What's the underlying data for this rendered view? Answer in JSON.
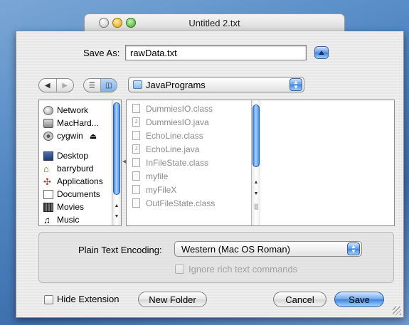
{
  "window": {
    "title": "Untitled 2.txt"
  },
  "save_as": {
    "label": "Save As:",
    "value": "rawData.txt"
  },
  "location": {
    "folder": "JavaPrograms"
  },
  "sidebar": {
    "devices": [
      {
        "label": "Network",
        "icon": "network-icon"
      },
      {
        "label": "MacHard...",
        "icon": "hard-drive-icon"
      },
      {
        "label": "cygwin",
        "icon": "disk-icon"
      }
    ],
    "places": [
      {
        "label": "Desktop",
        "icon": "desktop-icon"
      },
      {
        "label": "barryburd",
        "icon": "home-icon"
      },
      {
        "label": "Applications",
        "icon": "applications-icon"
      },
      {
        "label": "Documents",
        "icon": "documents-icon"
      },
      {
        "label": "Movies",
        "icon": "movies-icon"
      },
      {
        "label": "Music",
        "icon": "music-icon"
      }
    ]
  },
  "files": [
    "DummiesIO.class",
    "DummiesIO.java",
    "EchoLine.class",
    "EchoLine.java",
    "InFileState.class",
    "myfile",
    "myFileX",
    "OutFileState.class"
  ],
  "encoding": {
    "label": "Plain Text Encoding:",
    "value": "Western (Mac OS Roman)"
  },
  "ignore_rich": {
    "label": "Ignore rich text commands"
  },
  "bottom": {
    "hide_extension": "Hide Extension",
    "new_folder": "New Folder",
    "cancel": "Cancel",
    "save": "Save"
  }
}
